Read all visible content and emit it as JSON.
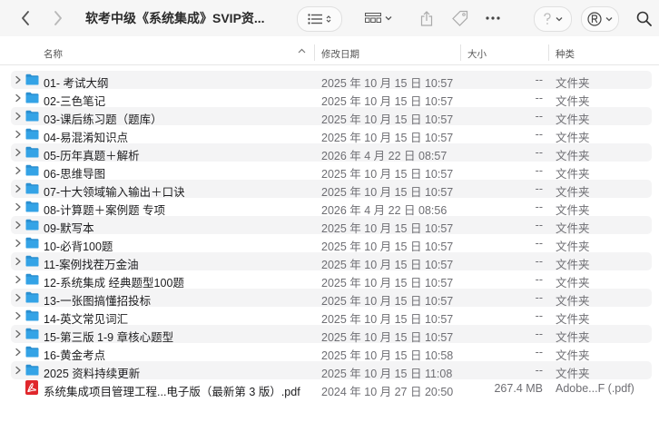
{
  "window": {
    "title": "软考中级《系统集成》SVIP资..."
  },
  "toolbar": {
    "back_icon": "chevron-left-icon",
    "forward_icon": "chevron-right-icon",
    "view_list_icon": "list-view-icon",
    "view_gallery_icon": "grid-view-icon",
    "share_icon": "share-icon",
    "tag_icon": "tag-icon",
    "more_icon": "ellipsis-icon",
    "help_icon": "question-icon",
    "registered_icon": "registered-icon",
    "search_icon": "search-icon"
  },
  "columns": {
    "name": "名称",
    "date": "修改日期",
    "size": "大小",
    "kind": "种类"
  },
  "colors": {
    "folder": "#34a3e6",
    "folder_dark": "#2b8fd0",
    "pdf": "#e0272c"
  },
  "files": [
    {
      "name": "01- 考试大纲",
      "date": "2025 年 10 月 15 日 10:57",
      "size": "--",
      "kind": "文件夹",
      "type": "folder"
    },
    {
      "name": "02-三色笔记",
      "date": "2025 年 10 月 15 日 10:57",
      "size": "--",
      "kind": "文件夹",
      "type": "folder"
    },
    {
      "name": "03-课后练习题（题库）",
      "date": "2025 年 10 月 15 日 10:57",
      "size": "--",
      "kind": "文件夹",
      "type": "folder"
    },
    {
      "name": "04-易混淆知识点",
      "date": "2025 年 10 月 15 日 10:57",
      "size": "--",
      "kind": "文件夹",
      "type": "folder"
    },
    {
      "name": "05-历年真题＋解析",
      "date": "2026 年 4 月 22 日 08:57",
      "size": "--",
      "kind": "文件夹",
      "type": "folder"
    },
    {
      "name": "06-思维导图",
      "date": "2025 年 10 月 15 日 10:57",
      "size": "--",
      "kind": "文件夹",
      "type": "folder"
    },
    {
      "name": "07-十大领域输入输出＋口诀",
      "date": "2025 年 10 月 15 日 10:57",
      "size": "--",
      "kind": "文件夹",
      "type": "folder"
    },
    {
      "name": "08-计算题＋案例题 专项",
      "date": "2026 年 4 月 22 日 08:56",
      "size": "--",
      "kind": "文件夹",
      "type": "folder"
    },
    {
      "name": "09-默写本",
      "date": "2025 年 10 月 15 日 10:57",
      "size": "--",
      "kind": "文件夹",
      "type": "folder"
    },
    {
      "name": "10-必背100题",
      "date": "2025 年 10 月 15 日 10:57",
      "size": "--",
      "kind": "文件夹",
      "type": "folder"
    },
    {
      "name": "11-案例找茬万金油",
      "date": "2025 年 10 月 15 日 10:57",
      "size": "--",
      "kind": "文件夹",
      "type": "folder"
    },
    {
      "name": "12-系统集成 经典题型100题",
      "date": "2025 年 10 月 15 日 10:57",
      "size": "--",
      "kind": "文件夹",
      "type": "folder"
    },
    {
      "name": "13-一张图搞懂招投标",
      "date": "2025 年 10 月 15 日 10:57",
      "size": "--",
      "kind": "文件夹",
      "type": "folder"
    },
    {
      "name": "14-英文常见词汇",
      "date": "2025 年 10 月 15 日 10:57",
      "size": "--",
      "kind": "文件夹",
      "type": "folder"
    },
    {
      "name": "15-第三版 1-9 章核心题型",
      "date": "2025 年 10 月 15 日 10:57",
      "size": "--",
      "kind": "文件夹",
      "type": "folder"
    },
    {
      "name": "16-黄金考点",
      "date": "2025 年 10 月 15 日 10:58",
      "size": "--",
      "kind": "文件夹",
      "type": "folder"
    },
    {
      "name": "2025 资料持续更新",
      "date": "2025 年 10 月 15 日 11:08",
      "size": "--",
      "kind": "文件夹",
      "type": "folder"
    },
    {
      "name": "系统集成项目管理工程...电子版（最新第 3 版）.pdf",
      "date": "2024 年 10 月 27 日 20:50",
      "size": "267.4 MB",
      "kind": "Adobe...F (.pdf)",
      "type": "pdf"
    }
  ]
}
